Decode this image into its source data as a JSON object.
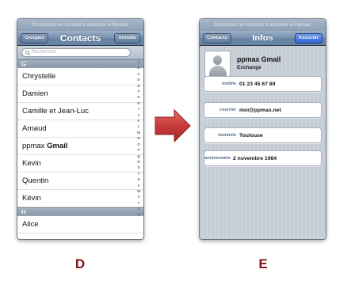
{
  "screen_d": {
    "prompt": "Choisissez un contact à associer à Ppmax.",
    "nav": {
      "left_button": "Groupes",
      "title": "Contacts",
      "right_button": "Annuler"
    },
    "search_placeholder": "Rechercher",
    "sections": [
      {
        "letter": "G",
        "contacts": [
          {
            "first": "Chrystelle",
            "last": ""
          },
          {
            "first": "Damien",
            "last": ""
          },
          {
            "first": "Camille et Jean-Luc",
            "last": ""
          },
          {
            "first": "Arnaud",
            "last": ""
          },
          {
            "first": "ppmax",
            "last": "Gmail"
          },
          {
            "first": "Kevin",
            "last": ""
          },
          {
            "first": "Quentin",
            "last": ""
          },
          {
            "first": "Kévin",
            "last": ""
          }
        ]
      },
      {
        "letter": "H",
        "contacts": [
          {
            "first": "Alice",
            "last": ""
          }
        ]
      }
    ],
    "index_letters": [
      "A",
      "B",
      "C",
      "D",
      "E",
      "F",
      "G",
      "H",
      "I",
      "J",
      "K",
      "L",
      "M",
      "N",
      "O",
      "P",
      "Q",
      "R",
      "S",
      "T",
      "U",
      "V",
      "W",
      "X",
      "Y",
      "Z",
      "#"
    ]
  },
  "screen_e": {
    "prompt": "Choisissez un contact à associer à Ppmax.",
    "nav": {
      "left_button": "Contacts",
      "title": "Infos",
      "right_button": "Associer"
    },
    "contact": {
      "name": "ppmax Gmail",
      "company": "Exchange",
      "avatar_icon": "person-silhouette-icon"
    },
    "fields": [
      {
        "label": "mobile",
        "value": "01 23 45 67 89"
      },
      {
        "label": "courrier",
        "value": "moi@ppmax.net"
      },
      {
        "label": "domicile",
        "value": "Toulouse"
      },
      {
        "label": "anniversaire",
        "value": "2 novembre 1984"
      }
    ]
  },
  "arrow_icon": "right-arrow-icon",
  "colors": {
    "arrow": "#c0393b",
    "caption": "#7e1619",
    "nav_primary": "#2f67d8"
  },
  "captions": {
    "left": "D",
    "right": "E"
  }
}
